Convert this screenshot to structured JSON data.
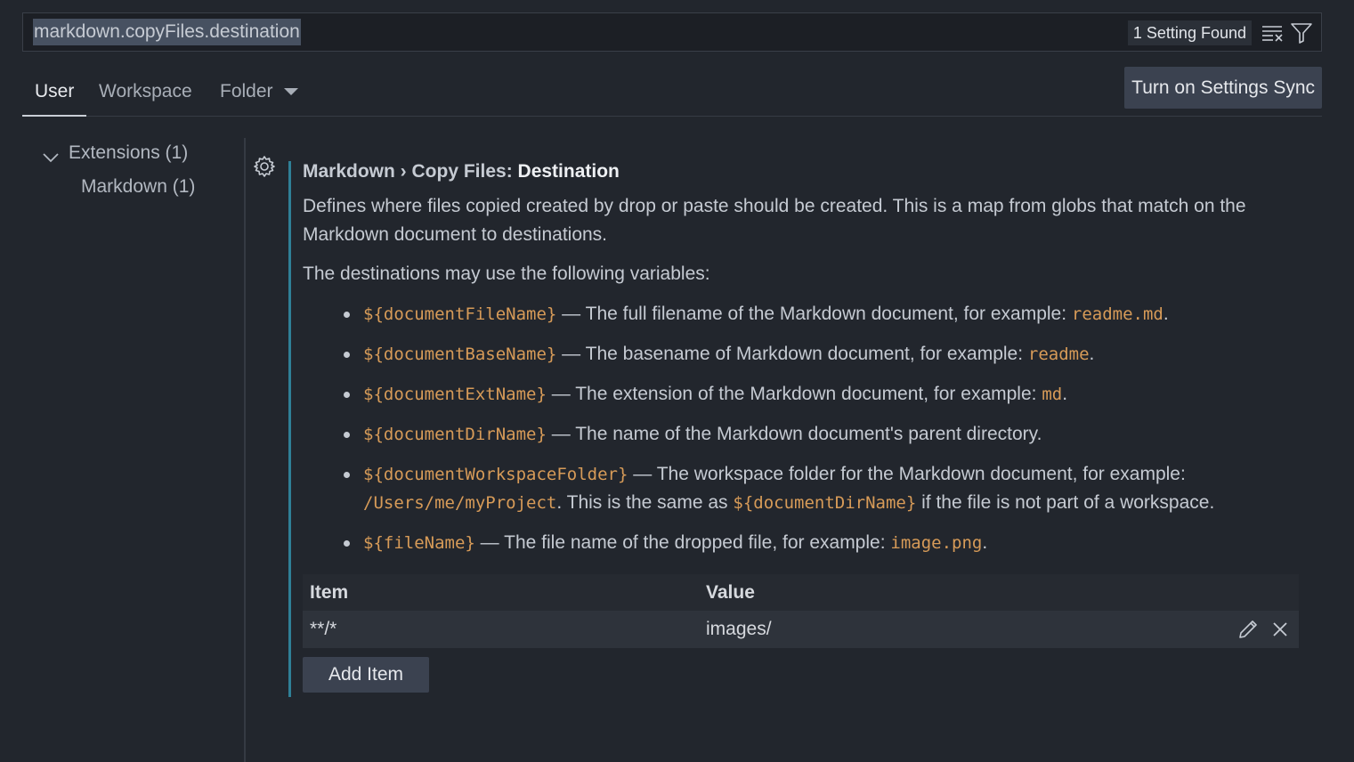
{
  "search": {
    "value": "markdown.copyFiles.destination",
    "results_count": "1 Setting Found",
    "clear_icon": "clear-filter-icon",
    "filter_icon": "filter-icon"
  },
  "tabs": [
    {
      "label": "User",
      "active": true
    },
    {
      "label": "Workspace",
      "active": false
    },
    {
      "label": "Folder",
      "active": false
    }
  ],
  "sync_button": "Turn on Settings Sync",
  "tree": {
    "group_label": "Extensions (1)",
    "item_label": "Markdown (1)"
  },
  "setting": {
    "category": "Markdown › Copy Files: ",
    "key": "Destination",
    "description": "Defines where files copied created by drop or paste should be created. This is a map from globs that match on the Markdown document to destinations.",
    "variables_intro": "The destinations may use the following variables:",
    "variables": [
      {
        "code": "${documentFileName}",
        "text": " — The full filename of the Markdown document, for example: ",
        "example": "readme.md",
        "tail": "."
      },
      {
        "code": "${documentBaseName}",
        "text": " — The basename of Markdown document, for example: ",
        "example": "readme",
        "tail": "."
      },
      {
        "code": "${documentExtName}",
        "text": " — The extension of the Markdown document, for example: ",
        "example": "md",
        "tail": "."
      },
      {
        "code": "${documentDirName}",
        "text": " — The name of the Markdown document's parent directory.",
        "example": "",
        "tail": ""
      },
      {
        "code": "${documentWorkspaceFolder}",
        "text": " — The workspace folder for the Markdown document, for example: ",
        "example": "/Users/me/myProject",
        "tail": ". This is the same as ",
        "code2": "${documentDirName}",
        "tail2": " if the file is not part of a workspace."
      },
      {
        "code": "${fileName}",
        "text": " — The file name of the dropped file, for example: ",
        "example": "image.png",
        "tail": "."
      }
    ]
  },
  "table": {
    "headers": {
      "item": "Item",
      "value": "Value"
    },
    "rows": [
      {
        "item": "**/*",
        "value": "images/"
      }
    ],
    "edit_icon": "pencil-icon",
    "remove_icon": "close-icon"
  },
  "add_item_label": "Add Item",
  "colors": {
    "background": "#22262d",
    "accent_modified": "#2f7f96",
    "code": "#d79b58",
    "button": "#3b4250"
  }
}
